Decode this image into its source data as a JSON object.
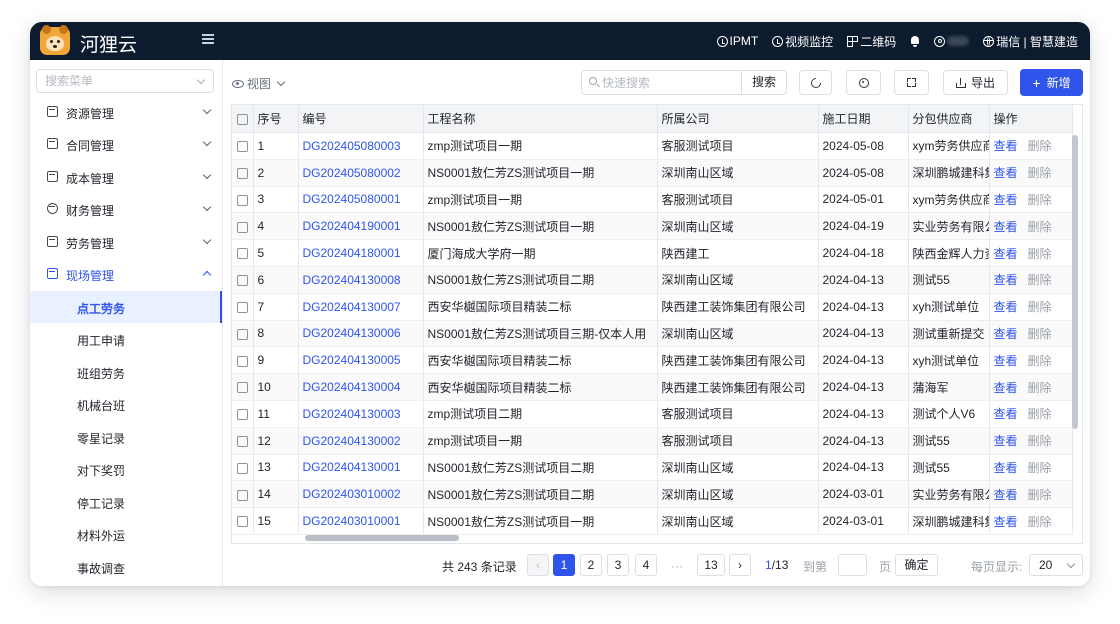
{
  "app": {
    "name": "河狸云"
  },
  "topbar": {
    "ipmt": "IPMT",
    "video": "视频监控",
    "qrcode": "二维码",
    "company": "瑞信 | 智慧建造"
  },
  "sidebar": {
    "search_placeholder": "搜索菜单",
    "menus": [
      {
        "label": "资源管理"
      },
      {
        "label": "合同管理"
      },
      {
        "label": "成本管理"
      },
      {
        "label": "财务管理"
      },
      {
        "label": "劳务管理"
      },
      {
        "label": "现场管理"
      }
    ],
    "sub_items": [
      {
        "label": "点工劳务"
      },
      {
        "label": "用工申请"
      },
      {
        "label": "班组劳务"
      },
      {
        "label": "机械台班"
      },
      {
        "label": "零星记录"
      },
      {
        "label": "对下奖罚"
      },
      {
        "label": "停工记录"
      },
      {
        "label": "材料外运"
      },
      {
        "label": "事故调查"
      }
    ]
  },
  "toolbar": {
    "view_label": "视图",
    "search_placeholder": "快速搜索",
    "search_button": "搜索",
    "export_label": "导出",
    "add_label": "新增"
  },
  "table": {
    "columns": [
      "序号",
      "编号",
      "工程名称",
      "所属公司",
      "施工日期",
      "分包供应商",
      "操作"
    ],
    "view_label": "查看",
    "delete_label": "删除",
    "rows": [
      {
        "no": "1",
        "code": "DG202405080003",
        "project": "zmp测试项目一期",
        "company": "客服测试项目",
        "date": "2024-05-08",
        "supplier": "xym劳务供应商"
      },
      {
        "no": "2",
        "code": "DG202405080002",
        "project": "NS0001敖仁芳ZS测试项目一期",
        "company": "深圳南山区域",
        "date": "2024-05-08",
        "supplier": "深圳鹏城建科集"
      },
      {
        "no": "3",
        "code": "DG202405080001",
        "project": "zmp测试项目一期",
        "company": "客服测试项目",
        "date": "2024-05-01",
        "supplier": "xym劳务供应商"
      },
      {
        "no": "4",
        "code": "DG202404190001",
        "project": "NS0001敖仁芳ZS测试项目一期",
        "company": "深圳南山区域",
        "date": "2024-04-19",
        "supplier": "实业劳务有限公"
      },
      {
        "no": "5",
        "code": "DG202404180001",
        "project": "厦门海成大学府一期",
        "company": "陕西建工",
        "date": "2024-04-18",
        "supplier": "陕西金辉人力资"
      },
      {
        "no": "6",
        "code": "DG202404130008",
        "project": "NS0001敖仁芳ZS测试项目二期",
        "company": "深圳南山区域",
        "date": "2024-04-13",
        "supplier": "测试55"
      },
      {
        "no": "7",
        "code": "DG202404130007",
        "project": "西安华樾国际项目精装二标",
        "company": "陕西建工装饰集团有限公司",
        "date": "2024-04-13",
        "supplier": "xyh测试单位"
      },
      {
        "no": "8",
        "code": "DG202404130006",
        "project": "NS0001敖仁芳ZS测试项目三期-仅本人用",
        "company": "深圳南山区域",
        "date": "2024-04-13",
        "supplier": "测试重新提交"
      },
      {
        "no": "9",
        "code": "DG202404130005",
        "project": "西安华樾国际项目精装二标",
        "company": "陕西建工装饰集团有限公司",
        "date": "2024-04-13",
        "supplier": "xyh测试单位"
      },
      {
        "no": "10",
        "code": "DG202404130004",
        "project": "西安华樾国际项目精装二标",
        "company": "陕西建工装饰集团有限公司",
        "date": "2024-04-13",
        "supplier": "蒲海军"
      },
      {
        "no": "11",
        "code": "DG202404130003",
        "project": "zmp测试项目二期",
        "company": "客服测试项目",
        "date": "2024-04-13",
        "supplier": "测试个人V6"
      },
      {
        "no": "12",
        "code": "DG202404130002",
        "project": "zmp测试项目一期",
        "company": "客服测试项目",
        "date": "2024-04-13",
        "supplier": "测试55"
      },
      {
        "no": "13",
        "code": "DG202404130001",
        "project": "NS0001敖仁芳ZS测试项目二期",
        "company": "深圳南山区域",
        "date": "2024-04-13",
        "supplier": "测试55"
      },
      {
        "no": "14",
        "code": "DG202403010002",
        "project": "NS0001敖仁芳ZS测试项目二期",
        "company": "深圳南山区域",
        "date": "2024-03-01",
        "supplier": "实业劳务有限公"
      },
      {
        "no": "15",
        "code": "DG202403010001",
        "project": "NS0001敖仁芳ZS测试项目一期",
        "company": "深圳南山区域",
        "date": "2024-03-01",
        "supplier": "深圳鹏城建科集"
      }
    ]
  },
  "pagination": {
    "total_text": "共 243 条记录",
    "pages": [
      "1",
      "2",
      "3",
      "4"
    ],
    "ellipsis": "···",
    "last_page": "13",
    "current": "1",
    "page_total": "/13",
    "goto_label": "到第",
    "page_unit": "页",
    "confirm_label": "确定",
    "page_size_label": "每页显示:",
    "page_size": "20"
  },
  "colors": {
    "primary": "#2f54eb",
    "topbar": "#0d1b2e"
  }
}
